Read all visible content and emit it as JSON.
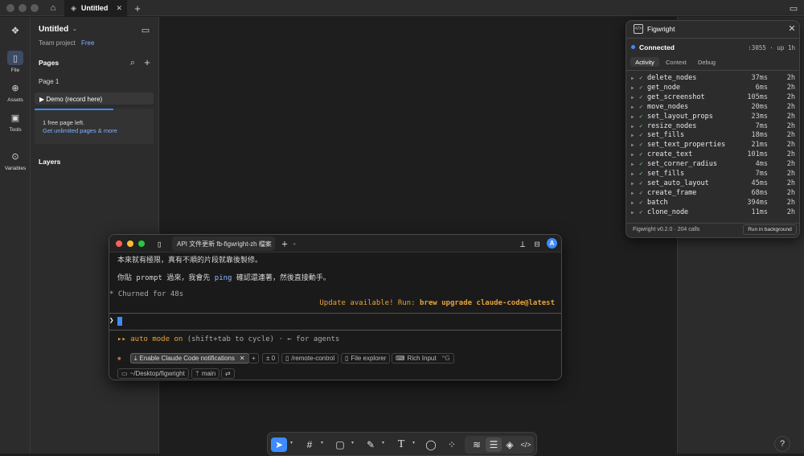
{
  "titlebar": {
    "tab_title": "Untitled"
  },
  "rail": {
    "items": [
      {
        "label": "File",
        "icon": "file-icon"
      },
      {
        "label": "Assets",
        "icon": "assets-icon"
      },
      {
        "label": "Tools",
        "icon": "toolbox-icon"
      },
      {
        "label": "Variables",
        "icon": "variables-icon"
      }
    ]
  },
  "sidebar": {
    "file_title": "Untitled",
    "project": "Team project",
    "plan_badge": "Free",
    "pages_heading": "Pages",
    "pages": [
      "Page 1",
      "▶ Demo (record here)"
    ],
    "limit_text": "1 free page left.",
    "limit_link": "Get unlimited pages & more",
    "layers_heading": "Layers"
  },
  "figwright": {
    "title": "Figwright",
    "status": "Connected",
    "port": ":3055 · up 1h",
    "tabs": [
      "Activity",
      "Context",
      "Debug"
    ],
    "rows": [
      {
        "name": "delete_nodes",
        "ms": "37ms",
        "age": "2h"
      },
      {
        "name": "get_node",
        "ms": "6ms",
        "age": "2h"
      },
      {
        "name": "get_screenshot",
        "ms": "105ms",
        "age": "2h"
      },
      {
        "name": "move_nodes",
        "ms": "20ms",
        "age": "2h"
      },
      {
        "name": "set_layout_props",
        "ms": "23ms",
        "age": "2h"
      },
      {
        "name": "resize_nodes",
        "ms": "7ms",
        "age": "2h"
      },
      {
        "name": "set_fills",
        "ms": "18ms",
        "age": "2h"
      },
      {
        "name": "set_text_properties",
        "ms": "21ms",
        "age": "2h"
      },
      {
        "name": "create_text",
        "ms": "101ms",
        "age": "2h"
      },
      {
        "name": "set_corner_radius",
        "ms": "4ms",
        "age": "2h"
      },
      {
        "name": "set_fills",
        "ms": "7ms",
        "age": "2h"
      },
      {
        "name": "set_auto_layout",
        "ms": "45ms",
        "age": "2h"
      },
      {
        "name": "create_frame",
        "ms": "68ms",
        "age": "2h"
      },
      {
        "name": "batch",
        "ms": "394ms",
        "age": "2h"
      },
      {
        "name": "clone_node",
        "ms": "11ms",
        "age": "2h"
      }
    ],
    "footer": "Figwright v0.2.0 · 204 calls",
    "bg_button": "Run in background"
  },
  "terminal": {
    "tab_title": "API 文件更新 fb-figwright-zh 檔案",
    "avatar": "A",
    "line1": "本來就有極限，真有不順的片段就靠後製修。",
    "line2_a": "你貼 ",
    "line2_b": "prompt",
    "line2_c": " 過來，我會先 ",
    "line2_d": "ping",
    "line2_e": " 確認還連著，然後直接動手。",
    "churned": "* Churned for 48s",
    "update_a": "Update available! Run: ",
    "update_b": "brew upgrade claude-code@latest",
    "prompt": "❯",
    "mode_a": "▸▸ auto mode on",
    "mode_b": " (shift+tab to cycle) · ← for agents",
    "chip_notif": "Enable Claude Code notifications",
    "chip_count": "± 0",
    "chip_remote": "/remote-control",
    "chip_explorer": "File explorer",
    "chip_rich": "Rich Input",
    "chip_rich_key": "^G",
    "chip_path": "~/Desktop/figwright",
    "chip_branch": "main"
  },
  "help": "?"
}
